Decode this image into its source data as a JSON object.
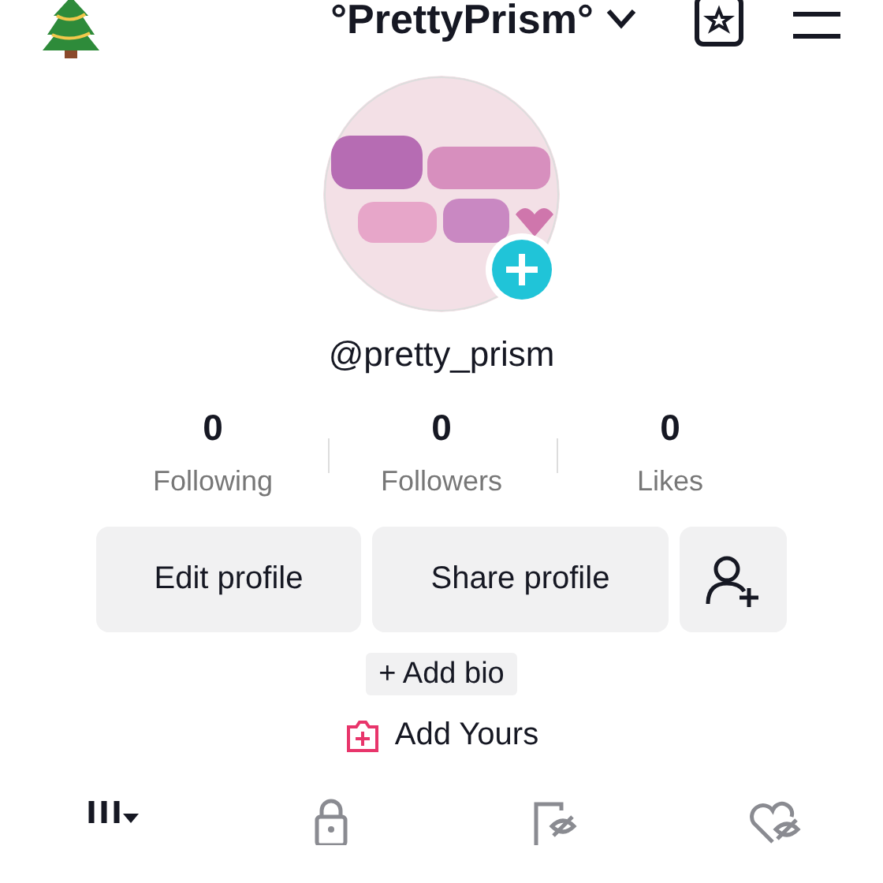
{
  "header": {
    "username": "°PrettyPrism°"
  },
  "profile": {
    "handle": "@pretty_prism",
    "has_add_badge": true
  },
  "stats": [
    {
      "value": "0",
      "label": "Following"
    },
    {
      "value": "0",
      "label": "Followers"
    },
    {
      "value": "0",
      "label": "Likes"
    }
  ],
  "buttons": [
    {
      "kind": "text",
      "label": "Edit profile"
    },
    {
      "kind": "text",
      "label": "Share profile"
    },
    {
      "kind": "add-friend"
    }
  ],
  "bio_button": "+ Add bio",
  "add_yours": "Add Yours",
  "tabs": [
    {
      "kind": "grid",
      "selected": true
    },
    {
      "kind": "lock",
      "selected": false
    },
    {
      "kind": "repost",
      "selected": false
    },
    {
      "kind": "liked",
      "selected": false
    }
  ]
}
